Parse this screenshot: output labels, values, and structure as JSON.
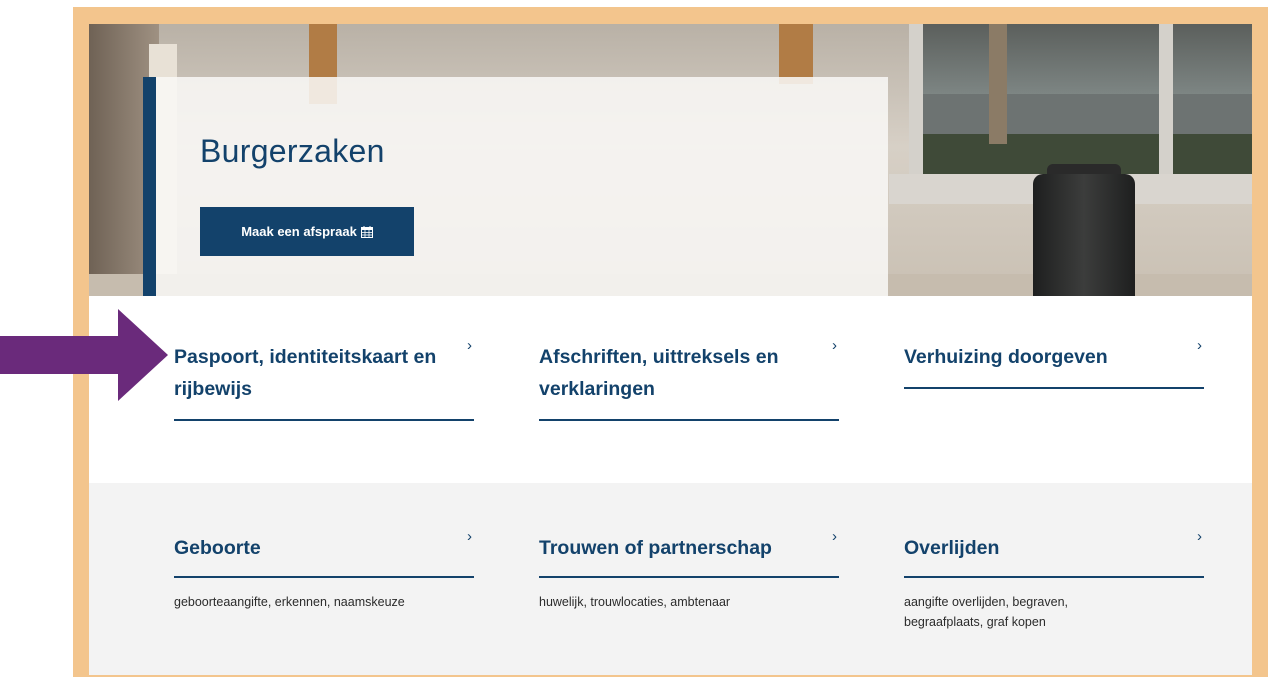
{
  "hero": {
    "title": "Burgerzaken",
    "button_label": "Maak een afspraak",
    "button_icon": "calendar-icon"
  },
  "tiles_primary": [
    {
      "title": "Paspoort, identiteitskaart en rijbewijs",
      "chevron": "›"
    },
    {
      "title": "Afschriften, uittreksels en verklaringen",
      "chevron": "›"
    },
    {
      "title": "Verhuizing doorgeven",
      "chevron": "›"
    }
  ],
  "tiles_secondary": [
    {
      "title": "Geboorte",
      "chevron": "›",
      "description": "geboorteaangifte, erkennen, naamskeuze"
    },
    {
      "title": "Trouwen of partnerschap",
      "chevron": "›",
      "description": "huwelijk, trouwlocaties, ambtenaar"
    },
    {
      "title": "Overlijden",
      "chevron": "›",
      "description": "aangifte overlijden, begraven, begraafplaats, graf kopen"
    }
  ],
  "colors": {
    "brand_blue": "#13426b",
    "frame": "#f3c58d",
    "arrow": "#6a2a7b",
    "grey_band": "#f3f3f3"
  }
}
